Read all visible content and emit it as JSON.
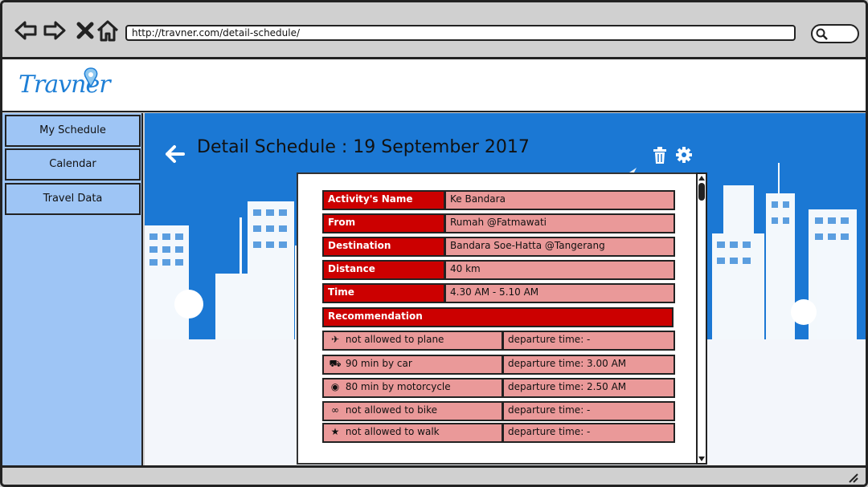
{
  "browser": {
    "url": "http://travner.com/detail-schedule/"
  },
  "header": {
    "logo_text": "Travner"
  },
  "sidebar": {
    "items": [
      {
        "label": "My Schedule"
      },
      {
        "label": "Calendar"
      },
      {
        "label": "Travel Data"
      }
    ]
  },
  "page": {
    "title": "Detail Schedule : 19 September 2017"
  },
  "details": [
    {
      "label": "Activity's Name",
      "value": "Ke Bandara"
    },
    {
      "label": "From",
      "value": "Rumah @Fatmawati"
    },
    {
      "label": "Destination",
      "value": "Bandara Soe-Hatta @Tangerang"
    },
    {
      "label": "Distance",
      "value": "40 km"
    },
    {
      "label": "Time",
      "value": "4.30 AM - 5.10 AM"
    }
  ],
  "recommendation": {
    "label": "Recommendation",
    "items": [
      {
        "icon": "plane-icon",
        "text": "not allowed to plane",
        "departure": "departure time: -"
      },
      {
        "icon": "car-icon",
        "text": "90 min by car",
        "departure": "departure time: 3.00 AM"
      },
      {
        "icon": "motorcycle-icon",
        "text": "80 min by motorcycle",
        "departure": "departure time: 2.50 AM"
      },
      {
        "icon": "bike-icon",
        "text": "not allowed to bike",
        "departure": "departure time: -"
      },
      {
        "icon": "walk-icon",
        "text": "not allowed to walk",
        "departure": "departure time: -"
      }
    ]
  },
  "colors": {
    "primary": "#1b78d4",
    "sidebar": "#9ec5f5",
    "label": "#cc0000",
    "value": "#ea9999"
  }
}
